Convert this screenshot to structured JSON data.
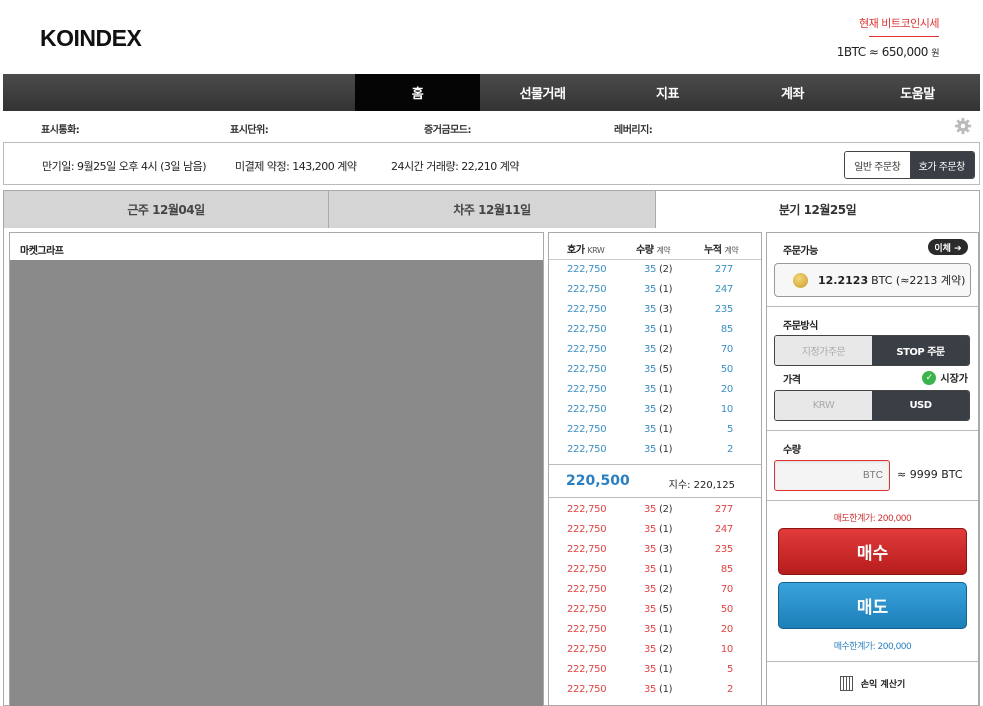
{
  "header": {
    "logo": "KOINDEX",
    "rate_title": "현재 비트코인시세",
    "rate_value": "1BTC ≈ 650,000",
    "rate_unit": "원"
  },
  "nav": {
    "items": [
      "홈",
      "선물거래",
      "지표",
      "계좌",
      "도움말"
    ],
    "active": "홈"
  },
  "options": {
    "display_currency": "표시통화:",
    "display_unit": "표시단위:",
    "margin_mode": "증거금모드:",
    "leverage": "레버리지:"
  },
  "info": {
    "expiry": "만기일: 9월25일 오후 4시 (3일 남음)",
    "open_interest": "미결제 약정: 143,200 계약",
    "volume_24h": "24시간 거래량: 22,210 계약",
    "view_normal": "일반 주문창",
    "view_orderbook": "호가 주문창"
  },
  "tabs": [
    "근주 12월04일",
    "차주 12월11일",
    "분기 12월25일"
  ],
  "graph": {
    "title": "마켓그라프"
  },
  "book": {
    "h_price": "호가",
    "h_price_unit": "KRW",
    "h_qty": "수량",
    "h_qty_unit": "계약",
    "h_cum": "누적",
    "h_cum_unit": "계약",
    "asks": [
      {
        "price": "222,750",
        "qty": "35",
        "cnt": "(2)",
        "cum": "277"
      },
      {
        "price": "222,750",
        "qty": "35",
        "cnt": "(1)",
        "cum": "247"
      },
      {
        "price": "222,750",
        "qty": "35",
        "cnt": "(3)",
        "cum": "235"
      },
      {
        "price": "222,750",
        "qty": "35",
        "cnt": "(1)",
        "cum": "85"
      },
      {
        "price": "222,750",
        "qty": "35",
        "cnt": "(2)",
        "cum": "70"
      },
      {
        "price": "222,750",
        "qty": "35",
        "cnt": "(5)",
        "cum": "50"
      },
      {
        "price": "222,750",
        "qty": "35",
        "cnt": "(1)",
        "cum": "20"
      },
      {
        "price": "222,750",
        "qty": "35",
        "cnt": "(2)",
        "cum": "10"
      },
      {
        "price": "222,750",
        "qty": "35",
        "cnt": "(1)",
        "cum": "5"
      },
      {
        "price": "222,750",
        "qty": "35",
        "cnt": "(1)",
        "cum": "2"
      }
    ],
    "current_price": "220,500",
    "index_label": "지수:",
    "index_value": "220,125",
    "bids": [
      {
        "price": "222,750",
        "qty": "35",
        "cnt": "(2)",
        "cum": "277"
      },
      {
        "price": "222,750",
        "qty": "35",
        "cnt": "(1)",
        "cum": "247"
      },
      {
        "price": "222,750",
        "qty": "35",
        "cnt": "(3)",
        "cum": "235"
      },
      {
        "price": "222,750",
        "qty": "35",
        "cnt": "(1)",
        "cum": "85"
      },
      {
        "price": "222,750",
        "qty": "35",
        "cnt": "(2)",
        "cum": "70"
      },
      {
        "price": "222,750",
        "qty": "35",
        "cnt": "(5)",
        "cum": "50"
      },
      {
        "price": "222,750",
        "qty": "35",
        "cnt": "(1)",
        "cum": "20"
      },
      {
        "price": "222,750",
        "qty": "35",
        "cnt": "(2)",
        "cum": "10"
      },
      {
        "price": "222,750",
        "qty": "35",
        "cnt": "(1)",
        "cum": "5"
      },
      {
        "price": "222,750",
        "qty": "35",
        "cnt": "(1)",
        "cum": "2"
      }
    ]
  },
  "panel": {
    "available_label": "주문가능",
    "transfer_label": "이체 ➔",
    "balance_amount": "12.2123",
    "balance_rest": "BTC  (≈2213 계약)",
    "method_label": "주문방식",
    "limit_order": "지정가주문",
    "stop_order": "STOP 주문",
    "price_label": "가격",
    "market_price": "시장가",
    "krw": "KRW",
    "usd": "USD",
    "qty_label": "수량",
    "qty_placeholder": "BTC",
    "qty_approx": "≈ 9999 BTC",
    "sell_limit": "매도한계가: 200,000",
    "buy_button": "매수",
    "sell_button": "매도",
    "buy_limit": "매수한계가: 200,000",
    "calculator": "손익 계산기"
  },
  "colors": {
    "ask": "#3a8fc4",
    "bid": "#d44444",
    "buy": "#d32f2f",
    "sell": "#2a93cc",
    "nav": "#3c3c3c"
  }
}
